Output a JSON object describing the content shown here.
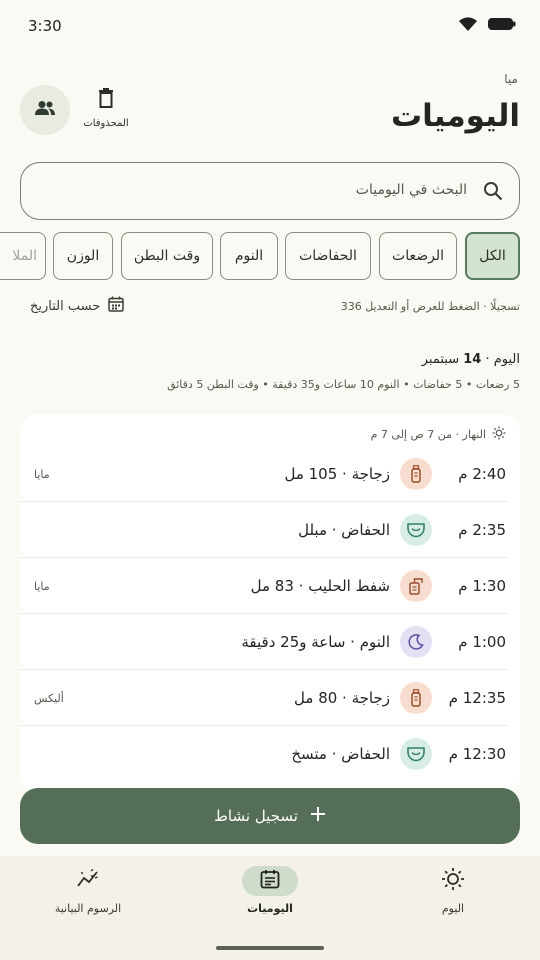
{
  "status_bar": {
    "time": "3:30"
  },
  "header": {
    "subtitle": "ميا",
    "title": "اليوميات",
    "trash_label": "المحذوفات"
  },
  "search": {
    "placeholder": "البحث في اليوميات"
  },
  "filters": {
    "chips": [
      "الكل",
      "الرضعات",
      "الحفاضات",
      "النوم",
      "وقت البطن",
      "الوزن",
      "الملا"
    ],
    "selected": "الكل"
  },
  "meta": {
    "count_text": "336 تسجيلًا · الضغط للعرض أو التعديل",
    "sort_label": "حسب التاريخ"
  },
  "day": {
    "label": "اليوم",
    "date_day": "14",
    "date_month": "سبتمبر",
    "summary": "5 رضعات • 5 حفاضات • النوم 10 ساعات و35 دقيقة • وقت البطن 5 دقائق",
    "period": "النهار · من 7 ص إلى 7 م",
    "entries": [
      {
        "time": "2:40 م",
        "text": "زجاجة · 105 مل",
        "owner": "مايا",
        "icon": "bottle-icon",
        "icon_bg": "#f6ddd0"
      },
      {
        "time": "2:35 م",
        "text": "الحفاض · مبلل",
        "owner": "",
        "icon": "diaper-icon",
        "icon_bg": "#d7ece5"
      },
      {
        "time": "1:30 م",
        "text": "شفط الحليب · 83 مل",
        "owner": "مايا",
        "icon": "pump-icon",
        "icon_bg": "#f6ddd0"
      },
      {
        "time": "1:00 م",
        "text": "النوم · ساعة و25 دقيقة",
        "owner": "",
        "icon": "moon-icon",
        "icon_bg": "#e3e0f4"
      },
      {
        "time": "12:35 م",
        "text": "زجاجة · 80 مل",
        "owner": "أليكس",
        "icon": "bottle-icon",
        "icon_bg": "#f6ddd0"
      },
      {
        "time": "12:30 م",
        "text": "الحفاض · متسخ",
        "owner": "",
        "icon": "diaper-icon",
        "icon_bg": "#d7ece5"
      }
    ]
  },
  "fab": {
    "label": "تسجيل نشاط"
  },
  "bottom_nav": [
    {
      "label": "الرسوم البيانية",
      "icon": "chart-icon",
      "active": false
    },
    {
      "label": "اليوميات",
      "icon": "journal-icon",
      "active": true
    },
    {
      "label": "اليوم",
      "icon": "sun-icon",
      "active": false
    }
  ],
  "colors": {
    "accent": "#546e58",
    "chip_active_bg": "#d4e3cf",
    "background": "#fbf9f3"
  }
}
